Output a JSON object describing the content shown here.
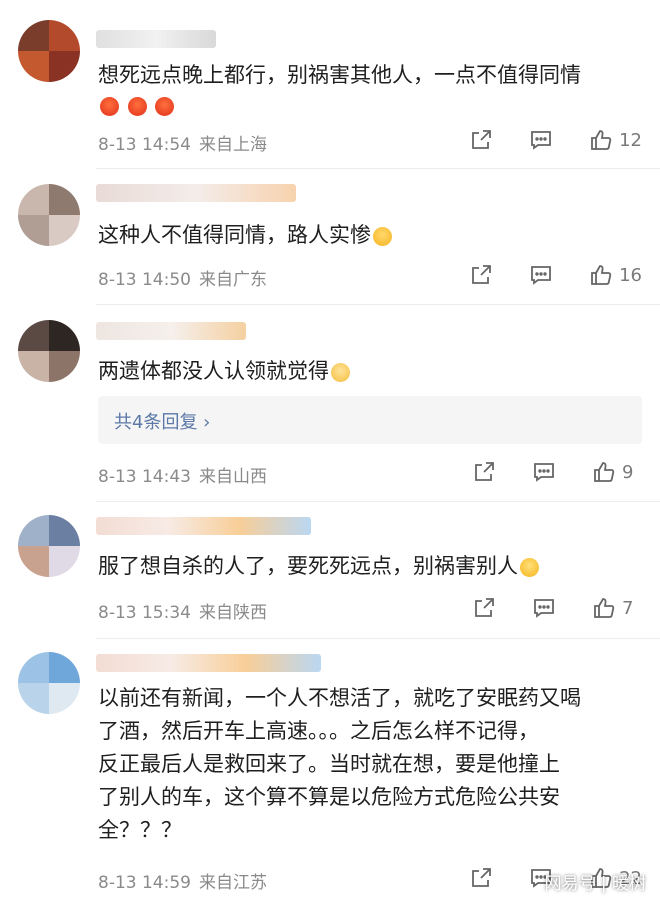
{
  "comments": [
    {
      "text": "想死远点晚上都行，别祸害其他人，一点不值得同情",
      "emojis": [
        "angry-red-emoji",
        "angry-red-emoji",
        "angry-red-emoji"
      ],
      "date": "8-13 14:54",
      "source": "来自上海",
      "likes": "12"
    },
    {
      "text": "这种人不值得同情，路人实惨",
      "emojis": [
        "crying-emoji"
      ],
      "date": "8-13 14:50",
      "source": "来自广东",
      "likes": "16"
    },
    {
      "text": "两遗体都没人认领就觉得",
      "emojis": [
        "thinking-emoji"
      ],
      "replies_label": "共4条回复 ›",
      "date": "8-13 14:43",
      "source": "来自山西",
      "likes": "9"
    },
    {
      "text": "服了想自杀的人了，要死死远点，别祸害别人",
      "emojis": [
        "sweat-emoji"
      ],
      "date": "8-13 15:34",
      "source": "来自陕西",
      "likes": "7"
    },
    {
      "text_lines": [
        "以前还有新闻，一个人不想活了，就吃了安眠药又喝",
        "了酒，然后开车上高速。。。之后怎么样不记得，",
        "反正最后人是救回来了。当时就在想，要是他撞上",
        "了别人的车，这个算不算是以危险方式危险公共安",
        "全？？？"
      ],
      "date": "8-13 14:59",
      "source": "来自江苏",
      "likes": "22"
    }
  ],
  "watermark": "网易号 | 暖树",
  "icons": {
    "repost": "repost-icon",
    "comment": "comment-icon",
    "like": "thumbs-up-icon"
  }
}
